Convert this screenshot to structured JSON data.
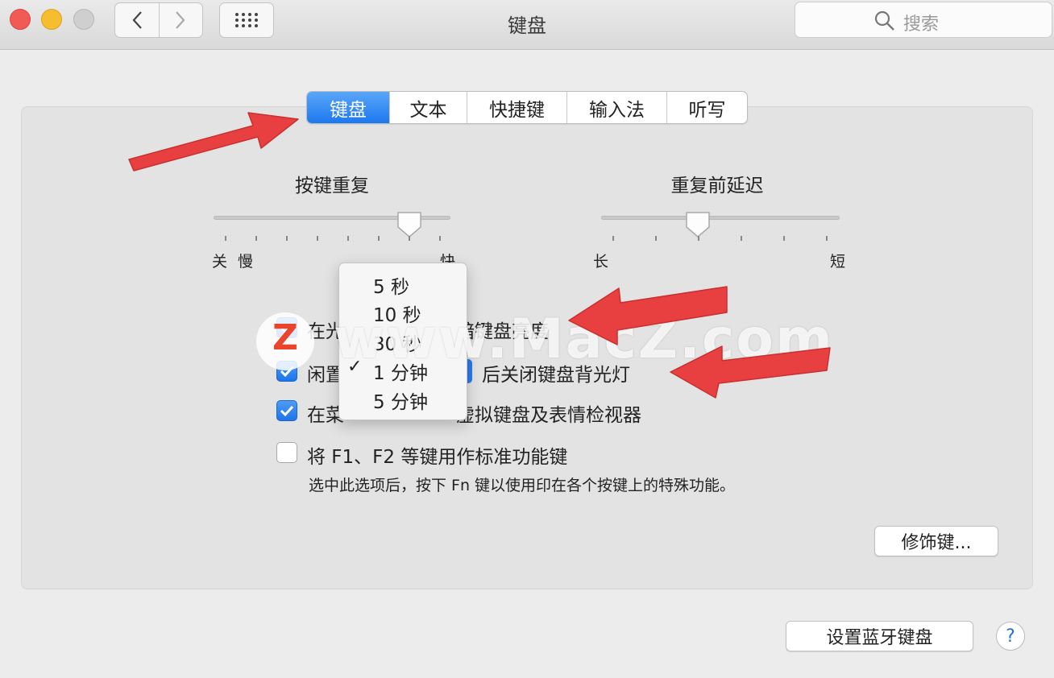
{
  "window": {
    "title": "键盘",
    "search_placeholder": "搜索"
  },
  "tabs": [
    {
      "label": "键盘",
      "active": true
    },
    {
      "label": "文本",
      "active": false
    },
    {
      "label": "快捷键",
      "active": false
    },
    {
      "label": "输入法",
      "active": false
    },
    {
      "label": "听写",
      "active": false
    }
  ],
  "key_repeat": {
    "label": "按键重复",
    "min_off_label": "关",
    "slow_label": "慢",
    "fast_label": "快",
    "level": 0.85
  },
  "repeat_delay": {
    "label": "重复前延迟",
    "long_label": "长",
    "short_label": "短",
    "level": 0.4
  },
  "options": {
    "light_adjust_prefix": "在光",
    "light_adjust_suffix": "暗键盘亮度",
    "idle_prefix": "闲置",
    "idle_suffix": "后关闭键盘背光灯",
    "menu_prefix": "在菜",
    "menu_suffix": "虚拟键盘及表情检视器",
    "fn_keys": "将 F1、F2 等键用作标准功能键",
    "fn_note": "选中此选项后，按下 Fn 键以使用印在各个按键上的特殊功能。"
  },
  "popup_menu": {
    "items": [
      "5 秒",
      "10 秒",
      "30 秒",
      "1 分钟",
      "5 分钟"
    ],
    "selected_index": 3,
    "check_glyph": "✓"
  },
  "buttons": {
    "modifier_keys": "修饰键...",
    "bluetooth_keyboard": "设置蓝牙键盘",
    "help": "?"
  },
  "watermark": {
    "logo_letter": "Z",
    "text": "www.MacZ.com"
  },
  "colors": {
    "accent": "#1d78ef",
    "annotation_arrow": "#e84040"
  }
}
